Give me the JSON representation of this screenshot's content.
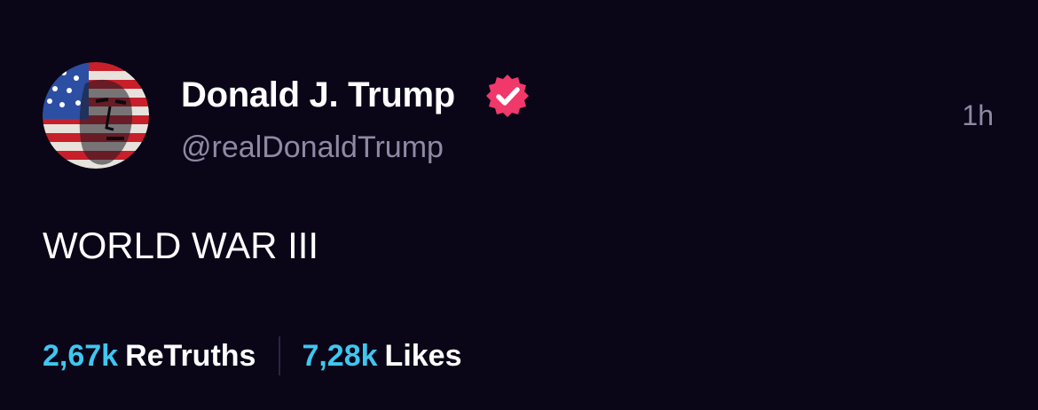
{
  "author": {
    "display_name": "Donald J. Trump",
    "handle": "@realDonaldTrump",
    "verified_icon": "verified-badge-icon",
    "avatar_icon": "avatar-image"
  },
  "post": {
    "timestamp": "1h",
    "text": "WORLD WAR III"
  },
  "stats": {
    "retruths_count": "2,67k",
    "retruths_label": "ReTruths",
    "likes_count": "7,28k",
    "likes_label": "Likes"
  },
  "colors": {
    "background": "#0a0618",
    "accent_count": "#3ec7f0",
    "muted_text": "#8f8aa3",
    "verified_badge": "#f0386b"
  }
}
